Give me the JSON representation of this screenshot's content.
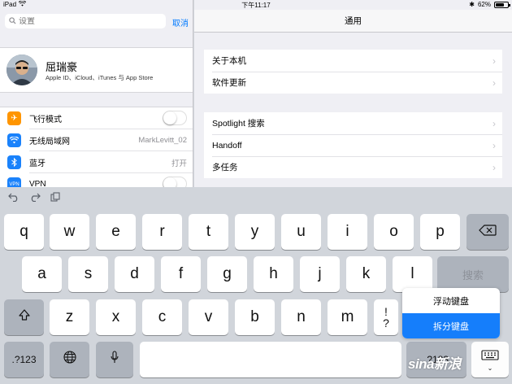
{
  "status_bar": {
    "device": "iPad",
    "time": "下午11:17",
    "battery": "62%"
  },
  "left_pane": {
    "search": {
      "placeholder": "设置",
      "cancel": "取消"
    },
    "profile": {
      "name": "屈瑞豪",
      "subtitle": "Apple ID、iCloud、iTunes 与 App Store"
    },
    "rows": [
      {
        "label": "飞行模式",
        "icon": "airplane-icon",
        "value": ""
      },
      {
        "label": "无线局域网",
        "icon": "wifi-icon",
        "value": "MarkLevitt_02"
      },
      {
        "label": "蓝牙",
        "icon": "bluetooth-icon",
        "value": "打开"
      },
      {
        "label": "VPN",
        "icon": "vpn-icon",
        "value": ""
      }
    ]
  },
  "right_pane": {
    "title": "通用",
    "group1": [
      "关于本机",
      "软件更新"
    ],
    "group2": [
      "Spotlight 搜索",
      "Handoff",
      "多任务"
    ]
  },
  "keyboard": {
    "row1": [
      "q",
      "w",
      "e",
      "r",
      "t",
      "y",
      "u",
      "i",
      "o",
      "p"
    ],
    "row2": [
      "a",
      "s",
      "d",
      "f",
      "g",
      "h",
      "j",
      "k",
      "l"
    ],
    "row3": [
      "z",
      "x",
      "c",
      "v",
      "b",
      "n",
      "m",
      "!",
      "?"
    ],
    "search_key": "搜索",
    "numbers_key": ".?123",
    "menu": {
      "floating": "浮动键盘",
      "split": "拆分键盘",
      "selected": "拆分键盘"
    }
  },
  "watermark": "sina新浪",
  "colors": {
    "accent": "#007aff",
    "selected": "#157efb",
    "airplane": "#ff9500",
    "system_blue": "#1a82fb"
  }
}
